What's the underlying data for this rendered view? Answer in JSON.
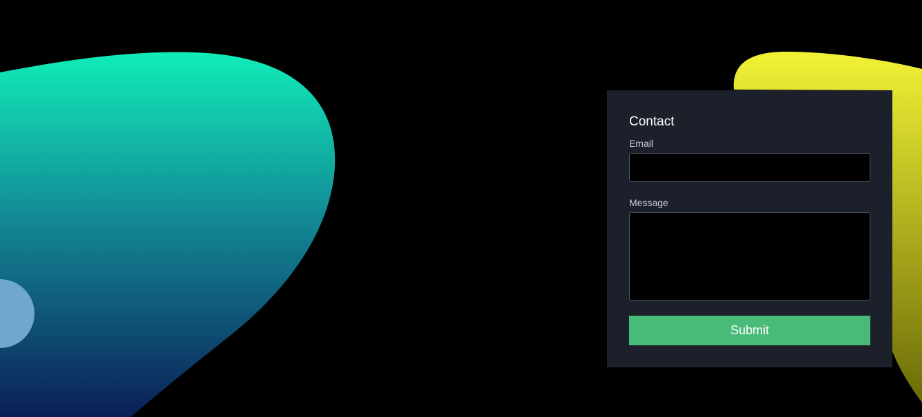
{
  "contact_form": {
    "title": "Contact",
    "email_label": "Email",
    "email_value": "",
    "message_label": "Message",
    "message_value": "",
    "submit_label": "Submit"
  },
  "colors": {
    "background": "#000000",
    "card_background": "#1c202b",
    "submit_button": "#48bb78",
    "left_blob_top": "#10edb8",
    "left_blob_bottom": "#0b1f57",
    "right_blob_top": "#f2f236",
    "right_blob_bottom": "#6b6b08",
    "circle": "#6fa8cc"
  }
}
